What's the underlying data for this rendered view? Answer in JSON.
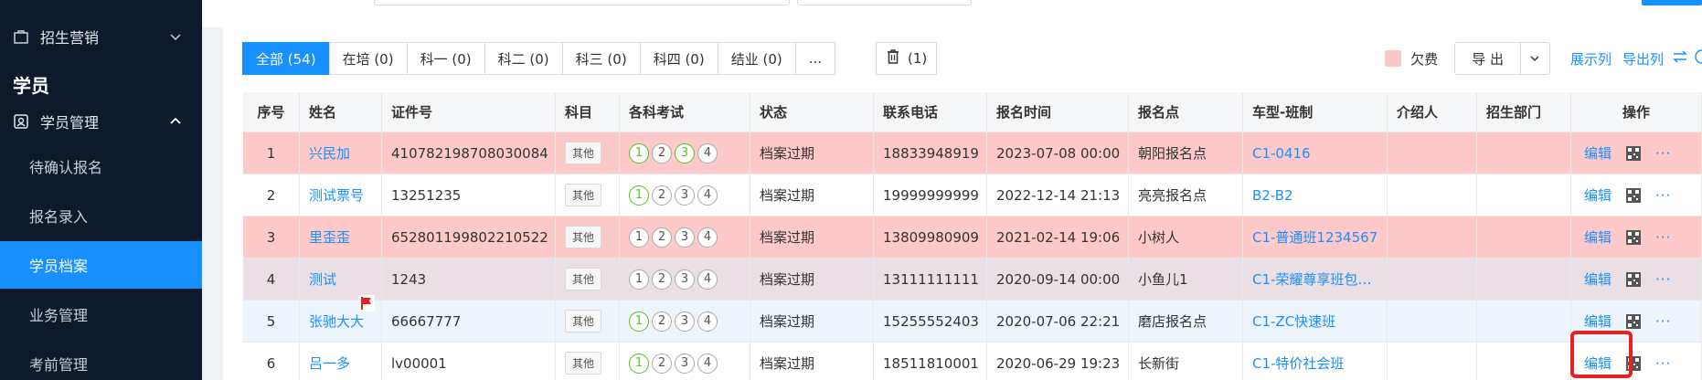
{
  "sidebar": {
    "recruit_label": "招生营销",
    "section_title": "学员",
    "student_mgmt_label": "学员管理",
    "items": [
      {
        "label": "待确认报名"
      },
      {
        "label": "报名录入"
      },
      {
        "label": "学员档案"
      },
      {
        "label": "业务管理"
      },
      {
        "label": "考前管理"
      }
    ]
  },
  "tabs": [
    {
      "label": "全部 (54)"
    },
    {
      "label": "在培 (0)"
    },
    {
      "label": "科一 (0)"
    },
    {
      "label": "科二 (0)"
    },
    {
      "label": "科三 (0)"
    },
    {
      "label": "科四 (0)"
    },
    {
      "label": "结业 (0)"
    },
    {
      "label": "..."
    }
  ],
  "trash": {
    "count": "(1)"
  },
  "tools": {
    "owe_label": "欠费",
    "export_label": "导 出",
    "display_cols": "展示列",
    "export_cols": "导出列"
  },
  "table": {
    "headers": [
      "序号",
      "姓名",
      "证件号",
      "科目",
      "各科考试",
      "状态",
      "联系电话",
      "报名时间",
      "报名点",
      "车型-班制",
      "介绍人",
      "招生部门",
      "操作"
    ],
    "rows": [
      {
        "no": "1",
        "name": "兴民加",
        "id": "410782198708030084",
        "subject": "其他",
        "exams": [
          "1",
          "2",
          "3",
          "4"
        ],
        "passed": [
          1,
          3
        ],
        "status": "档案过期",
        "phone": "18833948919",
        "time": "2023-07-08 00:00",
        "point": "朝阳报名点",
        "class": "C1-0416",
        "ref": "",
        "dept": ""
      },
      {
        "no": "2",
        "name": "测试票号",
        "id": "13251235",
        "subject": "其他",
        "exams": [
          "1",
          "2",
          "3",
          "4"
        ],
        "passed": [
          1
        ],
        "status": "档案过期",
        "phone": "19999999999",
        "time": "2022-12-14 21:13",
        "point": "亮亮报名点",
        "class": "B2-B2",
        "ref": "",
        "dept": ""
      },
      {
        "no": "3",
        "name": "里歪歪",
        "id": "652801199802210522",
        "subject": "其他",
        "exams": [
          "1",
          "2",
          "3",
          "4"
        ],
        "passed": [],
        "status": "档案过期",
        "phone": "13809980909",
        "time": "2021-02-14 19:06",
        "point": "小树人",
        "class": "C1-普通班1234567",
        "ref": "",
        "dept": ""
      },
      {
        "no": "4",
        "name": "测试",
        "id": "1243",
        "subject": "其他",
        "exams": [
          "1",
          "2",
          "3",
          "4"
        ],
        "passed": [],
        "status": "档案过期",
        "phone": "13111111111",
        "time": "2020-09-14 00:00",
        "point": "小鱼儿1",
        "class": "C1-荣耀尊享班包…",
        "ref": "",
        "dept": ""
      },
      {
        "no": "5",
        "name": "张驰大大",
        "id": "66667777",
        "subject": "其他",
        "exams": [
          "1",
          "2",
          "3",
          "4"
        ],
        "passed": [
          1
        ],
        "status": "档案过期",
        "phone": "15255552403",
        "time": "2020-07-06 22:21",
        "point": "磨店报名点",
        "class": "C1-ZC快速班",
        "ref": "",
        "dept": ""
      },
      {
        "no": "6",
        "name": "吕一多",
        "id": "lv00001",
        "subject": "其他",
        "exams": [
          "1",
          "2",
          "3",
          "4"
        ],
        "passed": [
          1
        ],
        "status": "档案过期",
        "phone": "18511810001",
        "time": "2020-06-29 19:23",
        "point": "长新街",
        "class": "C1-特价社会班",
        "ref": "",
        "dept": ""
      }
    ],
    "op_edit": "编辑",
    "op_more": "···"
  },
  "colors": {
    "accent": "#1890ff",
    "sidebar_bg": "#0e1a2b",
    "owe_row": "#fdc9c9",
    "pass": "#52c41a",
    "highlight": "#e52222"
  }
}
